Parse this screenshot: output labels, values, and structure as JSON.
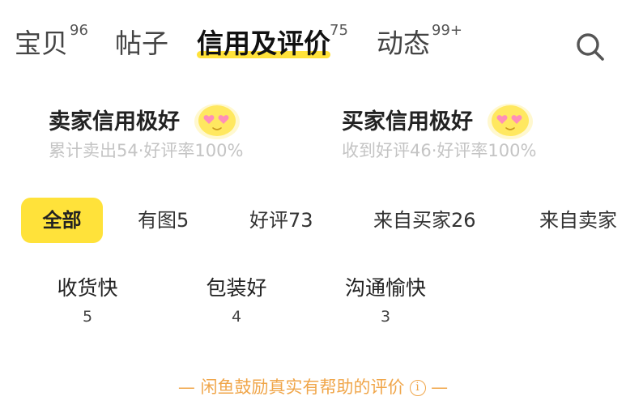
{
  "tabs": [
    {
      "label": "宝贝",
      "count": "96"
    },
    {
      "label": "帖子",
      "count": ""
    },
    {
      "label": "信用及评价",
      "count": "75"
    },
    {
      "label": "动态",
      "count": "99+"
    }
  ],
  "credit": {
    "seller": {
      "title": "卖家信用极好",
      "sub": "累计卖出54·好评率100%"
    },
    "buyer": {
      "title": "买家信用极好",
      "sub": "收到好评46·好评率100%"
    }
  },
  "filters": [
    "全部",
    "有图5",
    "好评73",
    "来自买家26",
    "来自卖家"
  ],
  "tags": [
    {
      "label": "收货快",
      "count": "5"
    },
    {
      "label": "包装好",
      "count": "4"
    },
    {
      "label": "沟通愉快",
      "count": "3"
    }
  ],
  "footer": {
    "note": "— 闲鱼鼓励真实有帮助的评价",
    "info_icon": "i",
    "tail": " —"
  },
  "colors": {
    "accent": "#ffe23a",
    "footer": "#f0a64a",
    "muted": "#c4c4c4"
  },
  "icons": {
    "search": "search-icon",
    "emoji": "heart-eyes-emoji-icon",
    "info": "info-icon"
  }
}
